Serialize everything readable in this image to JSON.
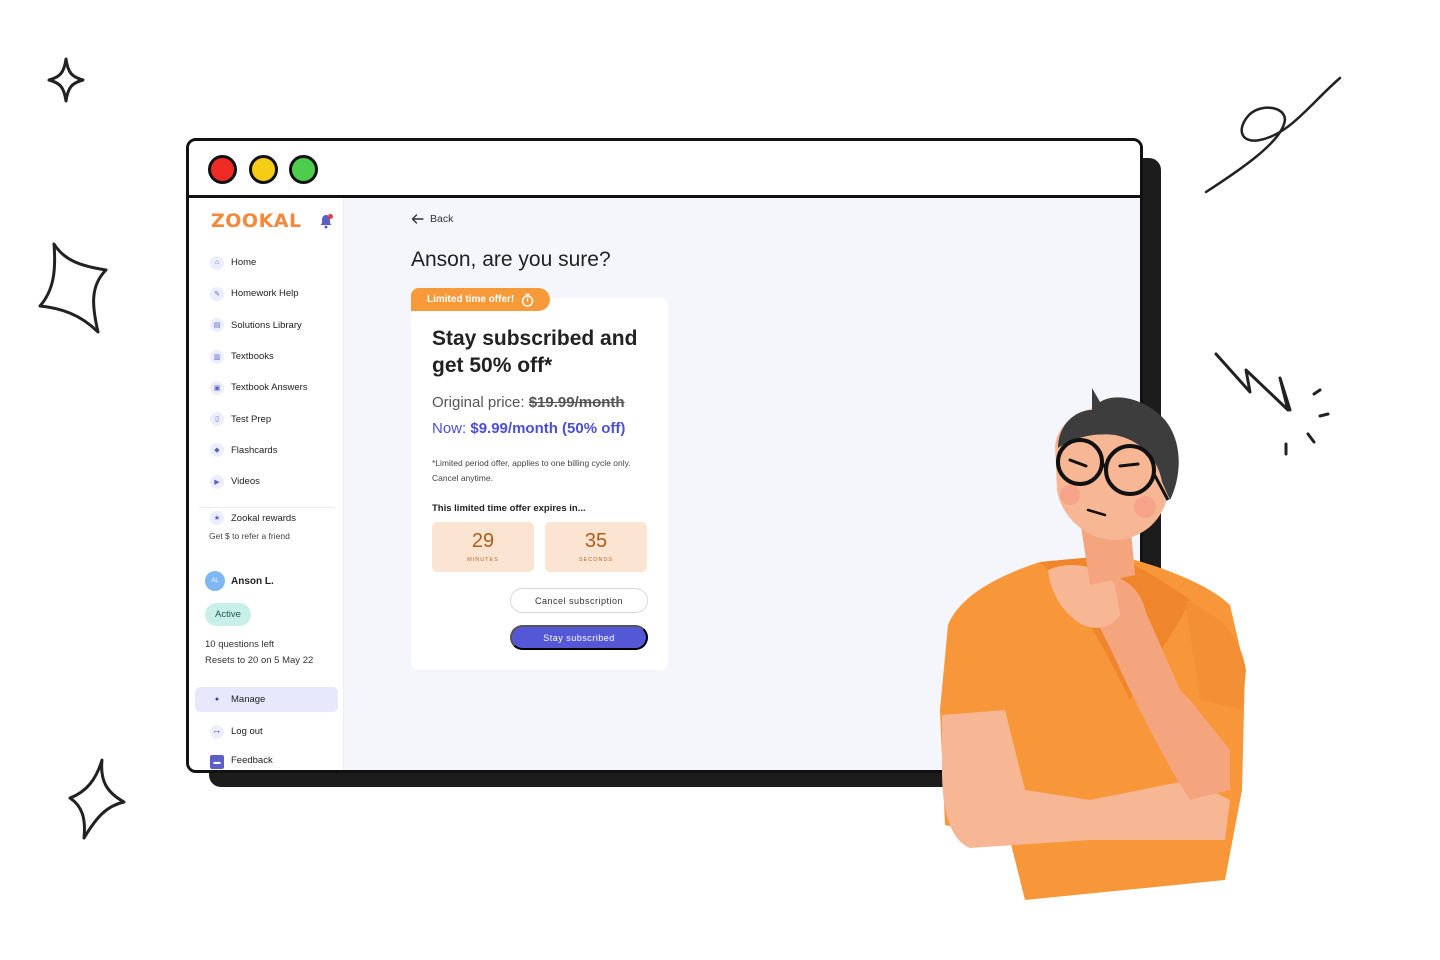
{
  "window": {
    "controls": [
      "close",
      "minimize",
      "maximize"
    ],
    "colors": {
      "close": "#ee2a24",
      "minimize": "#f7cc14",
      "maximize": "#4ccd4b"
    }
  },
  "sidebar": {
    "logo": "ZOOKAL",
    "notification_icon": "bell-icon",
    "items": [
      {
        "label": "Home",
        "icon": "home-icon"
      },
      {
        "label": "Homework Help",
        "icon": "pencil-icon"
      },
      {
        "label": "Solutions Library",
        "icon": "library-icon"
      },
      {
        "label": "Textbooks",
        "icon": "books-icon"
      },
      {
        "label": "Textbook Answers",
        "icon": "answers-icon"
      },
      {
        "label": "Test Prep",
        "icon": "test-icon"
      },
      {
        "label": "Flashcards",
        "icon": "flashcards-icon"
      },
      {
        "label": "Videos",
        "icon": "video-icon"
      }
    ],
    "rewards": {
      "label": "Zookal rewards",
      "subtitle": "Get $ to refer a friend"
    },
    "user": {
      "initials": "AL",
      "name": "Anson L.",
      "status": "Active",
      "questions_left": "10 questions left",
      "reset_note": "Resets to 20 on 5 May 22"
    },
    "manage_label": "Manage",
    "logout_label": "Log out",
    "feedback_label": "Feedback"
  },
  "main": {
    "back_label": "Back",
    "heading": "Anson, are you sure?",
    "offer": {
      "ribbon": "Limited time offer!",
      "title": "Stay subscribed and get 50% off*",
      "original_prefix": "Original price:",
      "original_price": "$19.99/month",
      "now_prefix": "Now:",
      "now_price": "$9.99/month (50% off)",
      "fine_print": "*Limited period offer, applies to one billing cycle only. Cancel anytime.",
      "expires_label": "This limited time offer expires in...",
      "minutes": "29",
      "minutes_label": "MINUTES",
      "seconds": "35",
      "seconds_label": "SECONDS",
      "cancel_button": "Cancel subscription",
      "stay_button": "Stay subscribed"
    }
  },
  "colors": {
    "brand_orange": "#f5883a",
    "accent_purple": "#5558d6",
    "ribbon": "#f79a3a",
    "timer_bg": "#fbe4d1"
  }
}
